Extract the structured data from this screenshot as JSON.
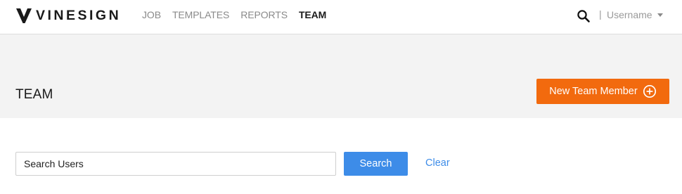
{
  "brand": {
    "name": "VINESIGN",
    "logo_icon": "vinesign-v-logo"
  },
  "nav": {
    "items": [
      {
        "label": "JOB",
        "active": false
      },
      {
        "label": "TEMPLATES",
        "active": false
      },
      {
        "label": "REPORTS",
        "active": false
      },
      {
        "label": "TEAM",
        "active": true
      }
    ]
  },
  "header": {
    "search_icon": "search-icon",
    "separator": "|",
    "username": "Username",
    "user_menu_icon": "caret-down-icon"
  },
  "page": {
    "title": "TEAM",
    "new_button_label": "New Team Member",
    "new_button_icon": "plus-circle-icon"
  },
  "search": {
    "placeholder": "Search Users",
    "value": "",
    "button_label": "Search",
    "clear_label": "Clear"
  },
  "colors": {
    "accent_orange": "#f26a0e",
    "primary_blue": "#3d8ce8",
    "band_grey": "#f3f3f3",
    "nav_inactive": "#8a8a8a",
    "text_dark": "#1a1a1a"
  }
}
